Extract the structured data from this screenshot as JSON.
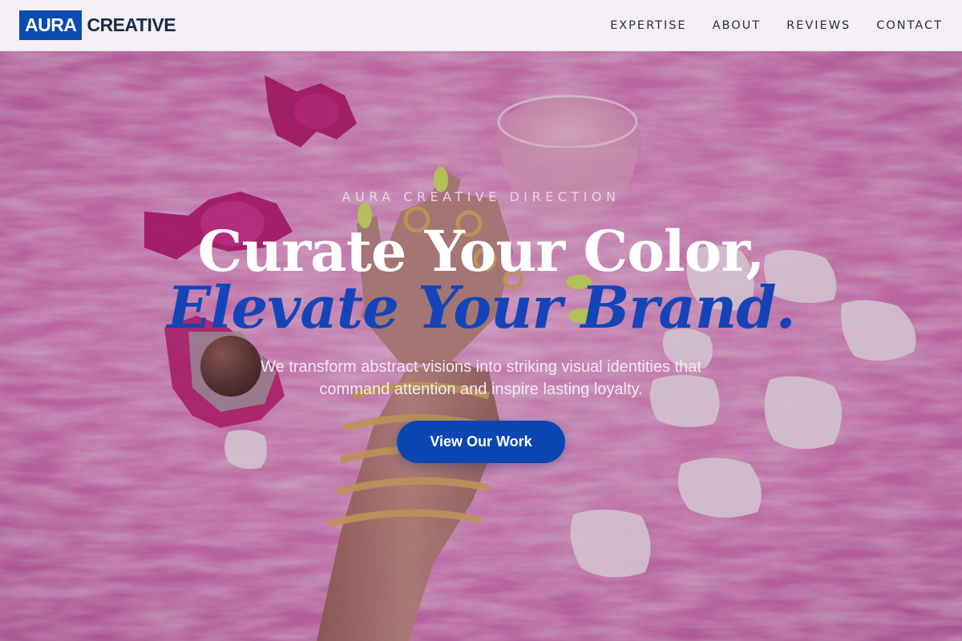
{
  "header": {
    "logo_mark": "AURA",
    "logo_text": "CREATIVE",
    "nav": [
      {
        "label": "EXPERTISE"
      },
      {
        "label": "ABOUT"
      },
      {
        "label": "REVIEWS"
      },
      {
        "label": "CONTACT"
      }
    ]
  },
  "hero": {
    "eyebrow": "AURA CREATIVE DIRECTION",
    "headline_line1": "Curate Your Color,",
    "headline_line2": "Elevate Your Brand.",
    "subtext": "We transform abstract visions into striking visual identities that command attention and inspire lasting loyalty.",
    "cta_label": "View Our Work"
  },
  "colors": {
    "accent": "#0a47b3",
    "header_bg": "#f3eff4",
    "hero_bg": "#d86fb0"
  }
}
